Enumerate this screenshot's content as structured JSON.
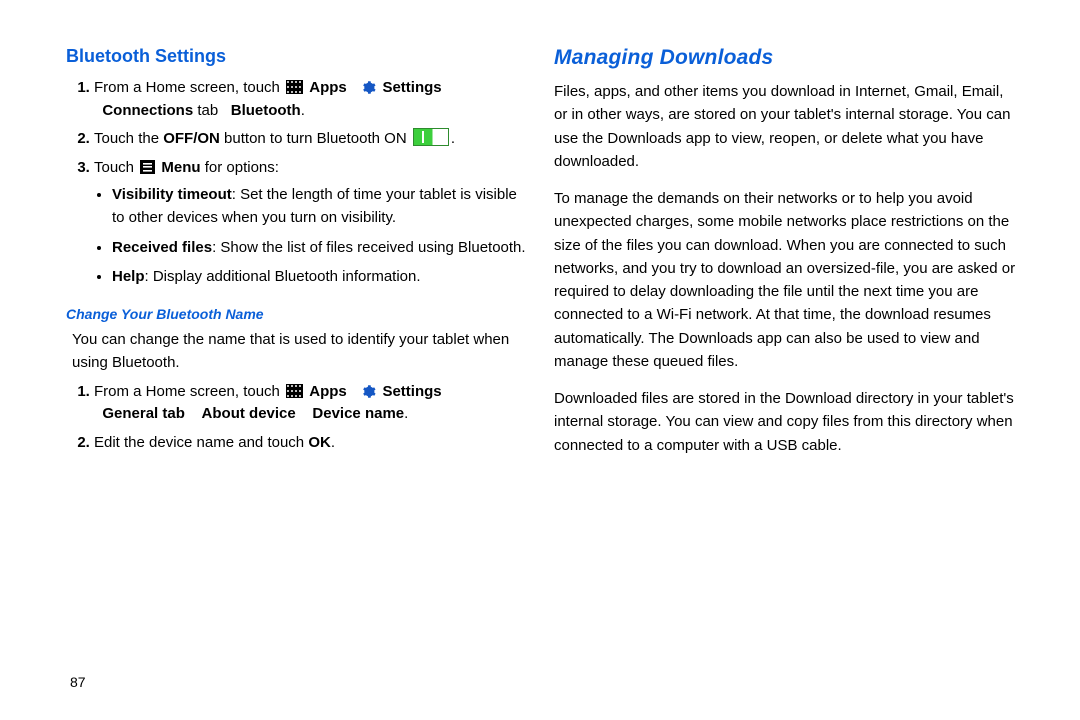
{
  "left": {
    "heading": "Bluetooth Settings",
    "step1": {
      "prefix": "From a Home screen, touch ",
      "apps_label": "Apps",
      "settings_label": "Settings",
      "line2_prefix": " ",
      "connections_label": "Connections",
      "tab_word": " tab ",
      "bluetooth_label": "Bluetooth"
    },
    "step2": {
      "prefix": "Touch the ",
      "offon": "OFF/ON",
      "mid": " button to turn Bluetooth ON "
    },
    "step3": {
      "prefix": "Touch ",
      "menu_label": "Menu",
      "suffix": " for options:"
    },
    "bullets": {
      "b1_label": "Visibility timeout",
      "b1_text": ": Set the length of time your tablet is visible to other devices when you turn on visibility.",
      "b2_label": "Received files",
      "b2_text": ": Show the list of files received using Bluetooth.",
      "b3_label": "Help",
      "b3_text": ": Display additional Bluetooth information."
    },
    "sub_heading": "Change Your Bluetooth Name",
    "sub_intro": "You can change the name that is used to identify your tablet when using Bluetooth.",
    "sub_step1": {
      "prefix": "From a Home screen, touch ",
      "apps_label": "Apps",
      "settings_label": "Settings",
      "general_label": "General tab",
      "about_label": "About device",
      "devicename_label": "Device name"
    },
    "sub_step2_prefix": "Edit the device name and touch ",
    "sub_step2_ok": "OK",
    "page_number": "87"
  },
  "right": {
    "heading": "Managing Downloads",
    "p1": "Files, apps, and other items you download in Internet, Gmail, Email, or in other ways, are stored on your tablet's internal storage. You can use the Downloads app to view, reopen, or delete what you have downloaded.",
    "p2": "To manage the demands on their networks or to help you avoid unexpected charges, some mobile networks place restrictions on the size of the files you can download. When you are connected to such networks, and you try to download an oversized-file, you are asked or required to delay downloading the file until the next time you are connected to a Wi-Fi network. At that time, the download resumes automatically. The Downloads app can also be used to view and manage these queued files.",
    "p3": "Downloaded files are stored in the Download directory in your tablet's internal storage. You can view and copy files from this directory when connected to a computer with a USB cable."
  }
}
